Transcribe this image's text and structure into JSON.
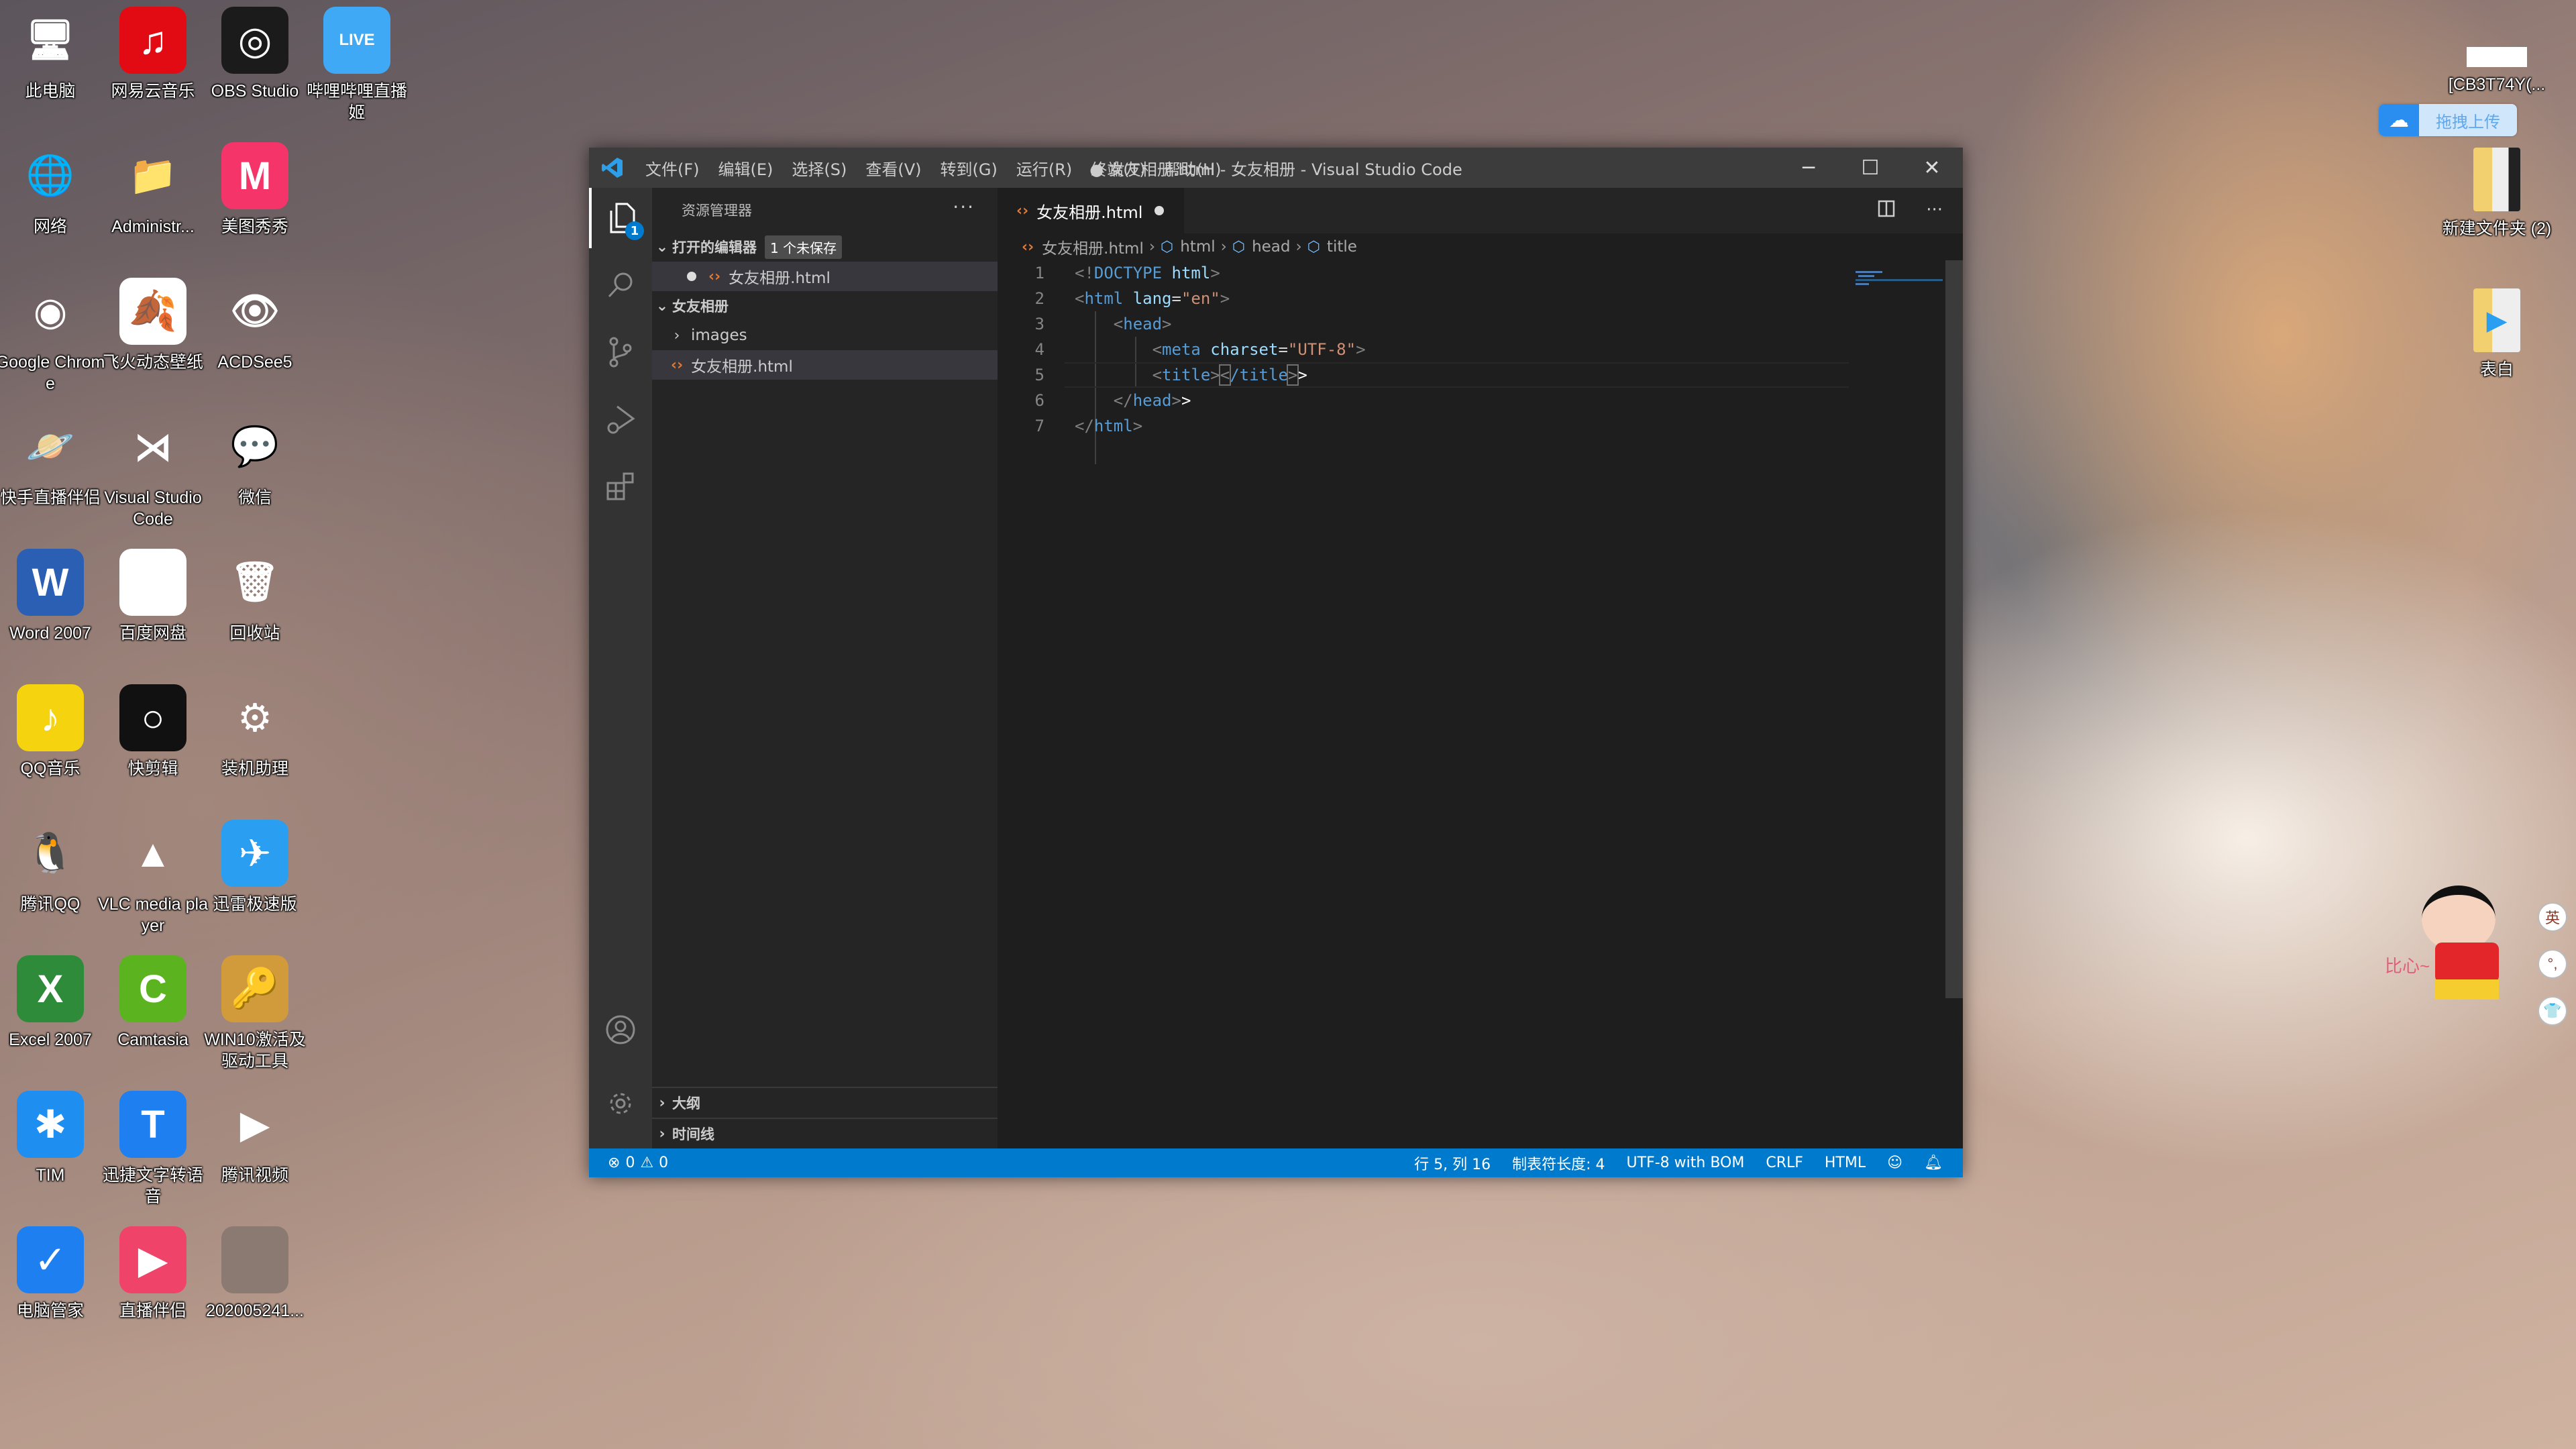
{
  "desktop": {
    "left_icons": [
      {
        "label": "此电脑",
        "icon": "this-pc-icon",
        "bg": "transparent",
        "glyph": "🖥",
        "col": 0,
        "row": 0
      },
      {
        "label": "网易云音乐",
        "icon": "netease-music-icon",
        "bg": "#e20a13",
        "glyph": "♫",
        "col": 1,
        "row": 0
      },
      {
        "label": "OBS Studio",
        "icon": "obs-studio-icon",
        "bg": "#1b1b1b",
        "glyph": "◎",
        "col": 2,
        "row": 0
      },
      {
        "label": "哔哩哔哩直播姬",
        "icon": "bilibili-live-icon",
        "bg": "#3fa9f5",
        "glyph": "LIVE",
        "col": 3,
        "row": 0
      },
      {
        "label": "网络",
        "icon": "network-icon",
        "bg": "transparent",
        "glyph": "🌐",
        "col": 0,
        "row": 1
      },
      {
        "label": "Administr...",
        "icon": "user-folder-icon",
        "bg": "transparent",
        "glyph": "📁",
        "col": 1,
        "row": 1
      },
      {
        "label": "美图秀秀",
        "icon": "meitu-icon",
        "bg": "#f5356a",
        "glyph": "M",
        "col": 2,
        "row": 1
      },
      {
        "label": "Google Chrome",
        "icon": "chrome-icon",
        "bg": "transparent",
        "glyph": "◉",
        "col": 0,
        "row": 2
      },
      {
        "label": "飞火动态壁纸",
        "icon": "feihuo-wallpaper-icon",
        "bg": "#ffffff",
        "glyph": "🍂",
        "col": 1,
        "row": 2
      },
      {
        "label": "ACDSee5",
        "icon": "acdsee-icon",
        "bg": "transparent",
        "glyph": "👁",
        "col": 2,
        "row": 2
      },
      {
        "label": "快手直播伴侣",
        "icon": "kuaishou-live-icon",
        "bg": "transparent",
        "glyph": "🪐",
        "col": 0,
        "row": 3
      },
      {
        "label": "Visual Studio Code",
        "icon": "vscode-icon",
        "bg": "transparent",
        "glyph": "⋊",
        "col": 1,
        "row": 3
      },
      {
        "label": "微信",
        "icon": "wechat-icon",
        "bg": "transparent",
        "glyph": "💬",
        "col": 2,
        "row": 3
      },
      {
        "label": "Word 2007",
        "icon": "word-icon",
        "bg": "#2b5fb4",
        "glyph": "W",
        "col": 0,
        "row": 4
      },
      {
        "label": "百度网盘",
        "icon": "baidu-netdisk-icon",
        "bg": "#ffffff",
        "glyph": "☁",
        "col": 1,
        "row": 4
      },
      {
        "label": "回收站",
        "icon": "recycle-bin-icon",
        "bg": "transparent",
        "glyph": "🗑",
        "col": 2,
        "row": 4
      },
      {
        "label": "QQ音乐",
        "icon": "qq-music-icon",
        "bg": "#f5d30f",
        "glyph": "♪",
        "col": 0,
        "row": 5
      },
      {
        "label": "快剪辑",
        "icon": "kuaijianji-icon",
        "bg": "#111111",
        "glyph": "○",
        "col": 1,
        "row": 5
      },
      {
        "label": "装机助理",
        "icon": "setup-assistant-icon",
        "bg": "transparent",
        "glyph": "⚙",
        "col": 2,
        "row": 5
      },
      {
        "label": "腾讯QQ",
        "icon": "qq-icon",
        "bg": "transparent",
        "glyph": "🐧",
        "col": 0,
        "row": 6
      },
      {
        "label": "VLC media player",
        "icon": "vlc-icon",
        "bg": "transparent",
        "glyph": "▲",
        "col": 1,
        "row": 6
      },
      {
        "label": "迅雷极速版",
        "icon": "xunlei-icon",
        "bg": "#2a9ef0",
        "glyph": "✈",
        "col": 2,
        "row": 6
      },
      {
        "label": "Excel 2007",
        "icon": "excel-icon",
        "bg": "#2e8b3a",
        "glyph": "X",
        "col": 0,
        "row": 7
      },
      {
        "label": "Camtasia",
        "icon": "camtasia-icon",
        "bg": "#5cb320",
        "glyph": "C",
        "col": 1,
        "row": 7
      },
      {
        "label": "WIN10激活及驱动工具",
        "icon": "key-tool-icon",
        "bg": "#d19a3a",
        "glyph": "🔑",
        "col": 2,
        "row": 7
      },
      {
        "label": "TIM",
        "icon": "tim-icon",
        "bg": "#1e8ef0",
        "glyph": "✱",
        "col": 0,
        "row": 8
      },
      {
        "label": "迅捷文字转语音",
        "icon": "xunjie-tts-icon",
        "bg": "#1e7ff0",
        "glyph": "T",
        "col": 1,
        "row": 8
      },
      {
        "label": "腾讯视频",
        "icon": "tencent-video-icon",
        "bg": "transparent",
        "glyph": "▶",
        "col": 2,
        "row": 8
      },
      {
        "label": "电脑管家",
        "icon": "pc-manager-icon",
        "bg": "#1e7ff0",
        "glyph": "✓",
        "col": 0,
        "row": 9
      },
      {
        "label": "直播伴侣",
        "icon": "live-companion-icon",
        "bg": "#f0436a",
        "glyph": "▶",
        "col": 1,
        "row": 9
      },
      {
        "label": "202005241...",
        "icon": "image-file-icon",
        "bg": "#8a7a72",
        "glyph": "",
        "col": 2,
        "row": 9
      }
    ],
    "right_icons": [
      {
        "label": "[CB3T74Y(...",
        "icon": "document-thumbnail-icon"
      },
      {
        "label": "新建文件夹 (2)",
        "icon": "folder-icon"
      },
      {
        "label": "表白",
        "icon": "folder-icon"
      }
    ],
    "baidu_upload": {
      "label": "拖拽上传"
    },
    "mascot_text": "比心~",
    "ime_buttons": [
      "英",
      "°,",
      "👕"
    ]
  },
  "window": {
    "title": "● 女友相册.html - 女友相册 - Visual Studio Code",
    "menu": [
      "文件(F)",
      "编辑(E)",
      "选择(S)",
      "查看(V)",
      "转到(G)",
      "运行(R)",
      "终端(T)",
      "帮助(H)"
    ],
    "controls": {
      "minimize": "─",
      "maximize": "☐",
      "close": "✕"
    }
  },
  "activity_bar": {
    "explorer_badge": "1"
  },
  "sidebar": {
    "title": "资源管理器",
    "more": "···",
    "open_editors": {
      "label": "打开的编辑器",
      "unsaved_badge": "1 个未保存",
      "files": [
        "女友相册.html"
      ]
    },
    "folder": {
      "label": "女友相册",
      "items": [
        {
          "name": "images",
          "type": "folder"
        },
        {
          "name": "女友相册.html",
          "type": "html"
        }
      ]
    },
    "outline_label": "大纲",
    "timeline_label": "时间线"
  },
  "editor": {
    "tab": {
      "label": "女友相册.html",
      "dirty": true
    },
    "breadcrumb": [
      "女友相册.html",
      "html",
      "head",
      "title"
    ],
    "lines": [
      {
        "n": "1",
        "tokens": [
          [
            "p",
            "<!"
          ],
          [
            "t",
            "DOCTYPE"
          ],
          [
            "x",
            " "
          ],
          [
            "a",
            "html"
          ],
          [
            "p",
            ">"
          ]
        ]
      },
      {
        "n": "2",
        "tokens": [
          [
            "p",
            "<"
          ],
          [
            "t",
            "html"
          ],
          [
            "x",
            " "
          ],
          [
            "a",
            "lang"
          ],
          [
            "x",
            "="
          ],
          [
            "s",
            "\"en\""
          ],
          [
            "p",
            ">"
          ]
        ]
      },
      {
        "n": "3",
        "tokens": [
          [
            "x",
            "    "
          ],
          [
            "p",
            "<"
          ],
          [
            "t",
            "head"
          ],
          [
            "p",
            ">"
          ]
        ]
      },
      {
        "n": "4",
        "tokens": [
          [
            "x",
            "        "
          ],
          [
            "p",
            "<"
          ],
          [
            "t",
            "meta"
          ],
          [
            "x",
            " "
          ],
          [
            "a",
            "charset"
          ],
          [
            "x",
            "="
          ],
          [
            "s",
            "\"UTF-8\""
          ],
          [
            "p",
            ">"
          ]
        ]
      },
      {
        "n": "5",
        "tokens": [
          [
            "x",
            "        "
          ],
          [
            "p",
            "<"
          ],
          [
            "t",
            "title"
          ],
          [
            "p",
            ">"
          ],
          [
            "bp",
            "<"
          ],
          [
            "t",
            "/title"
          ],
          [
            "bp",
            ">"
          ],
          [
            "w",
            ">"
          ]
        ]
      },
      {
        "n": "6",
        "tokens": [
          [
            "x",
            "    "
          ],
          [
            "p",
            "</"
          ],
          [
            "t",
            "head"
          ],
          [
            "p",
            ">"
          ],
          [
            "w",
            ">"
          ]
        ]
      },
      {
        "n": "7",
        "tokens": [
          [
            "p",
            "</"
          ],
          [
            "t",
            "html"
          ],
          [
            "p",
            ">"
          ]
        ]
      }
    ]
  },
  "status_bar": {
    "errors": "0",
    "warnings": "0",
    "position": "行 5, 列 16",
    "tab_size": "制表符长度: 4",
    "encoding": "UTF-8 with BOM",
    "eol": "CRLF",
    "language": "HTML"
  }
}
